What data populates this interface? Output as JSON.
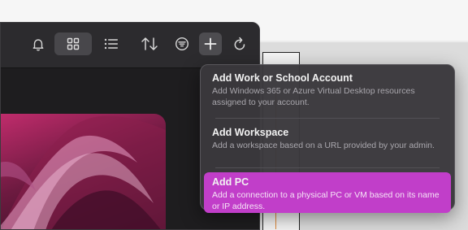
{
  "toolbar": {
    "icons": [
      "bell-icon",
      "grid-view-icon",
      "list-view-icon",
      "sort-icon",
      "filter-icon",
      "plus-icon",
      "refresh-icon"
    ]
  },
  "menu": {
    "items": [
      {
        "title": "Add Work or School Account",
        "description": "Add Windows 365 or Azure Virtual Desktop resources assigned to your account."
      },
      {
        "title": "Add Workspace",
        "description": "Add a workspace based on a URL provided by your admin."
      },
      {
        "title": "Add PC",
        "description": "Add a connection to a physical PC or VM based on its name or IP address.",
        "selected": true
      }
    ]
  },
  "colors": {
    "selected_highlight": "#c13ec9",
    "window_background": "#1e1d1f",
    "toolbar_background": "#2c2b2e",
    "menu_background": "#3a383c"
  }
}
